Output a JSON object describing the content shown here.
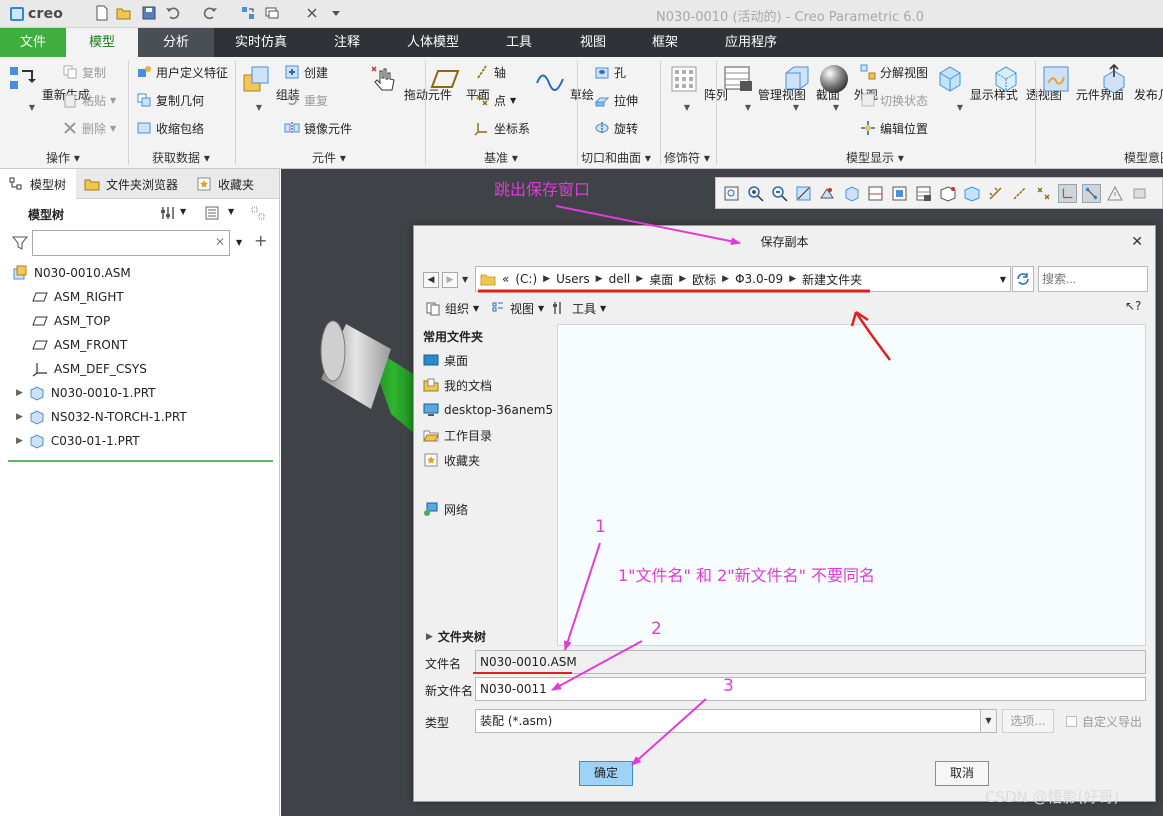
{
  "app": {
    "logo": "creo",
    "window_title": "N030-0010 (活动的) - Creo Parametric 6.0"
  },
  "tabs": [
    "文件",
    "模型",
    "分析",
    "实时仿真",
    "注释",
    "人体模型",
    "工具",
    "视图",
    "框架",
    "应用程序"
  ],
  "ribbon": {
    "operations": {
      "regenerate": "重新生成",
      "copy": "复制",
      "paste": "粘贴",
      "delete": "删除",
      "label": "操作"
    },
    "get_data": {
      "udf": "用户定义特征",
      "copy_geometry": "复制几何",
      "shrinkwrap": "收缩包络",
      "label": "获取数据"
    },
    "component": {
      "assemble": "组装",
      "create": "创建",
      "repeat": "重复",
      "mirror": "镜像元件",
      "drag": "拖动元件",
      "label": "元件"
    },
    "datum": {
      "plane": "平面",
      "axis": "轴",
      "point": "点",
      "csys": "坐标系",
      "sketch": "草绘",
      "label": "基准"
    },
    "cut_surface": {
      "hole": "孔",
      "extrude": "拉伸",
      "revolve": "旋转",
      "label": "切口和曲面"
    },
    "modifiers": {
      "pattern": "阵列",
      "label": "修饰符"
    },
    "model_display": {
      "manage_views": "管理视图",
      "section": "截面",
      "appearance": "外观",
      "explode": "分解视图",
      "toggle_status": "切换状态",
      "edit_position": "编辑位置",
      "display_style": "显示样式",
      "perspective": "透视图",
      "label": "模型显示"
    },
    "model_intent": {
      "component_interface": "元件界面",
      "publish_geometry": "发布几何",
      "label": "模型意图"
    }
  },
  "left_panel": {
    "tabs": [
      "模型树",
      "文件夹浏览器",
      "收藏夹"
    ],
    "tree_title": "模型树",
    "filter_placeholder": "",
    "tree_items": [
      "N030-0010.ASM",
      "ASM_RIGHT",
      "ASM_TOP",
      "ASM_FRONT",
      "ASM_DEF_CSYS",
      "N030-0010-1.PRT",
      "NS032-N-TORCH-1.PRT",
      "C030-01-1.PRT"
    ]
  },
  "dialog": {
    "title": "保存副本",
    "path": [
      "«",
      "(C:)",
      "Users",
      "dell",
      "桌面",
      "欧标",
      "Φ3.0-09",
      "新建文件夹"
    ],
    "search_placeholder": "搜索...",
    "toolbar": {
      "organize": "组织",
      "views": "视图",
      "tools": "工具"
    },
    "nav_heading": "常用文件夹",
    "nav_items": [
      "桌面",
      "我的文档",
      "desktop-36anem5",
      "工作目录",
      "收藏夹",
      "网络"
    ],
    "folder_tree": "文件夹树",
    "filename_label": "文件名",
    "filename_value": "N030-0010.ASM",
    "newname_label": "新文件名",
    "newname_value": "N030-0011",
    "type_label": "类型",
    "type_value": "装配 (*.asm)",
    "options_button": "选项...",
    "custom_export": "自定义导出",
    "ok_button": "确定",
    "cancel_button": "取消"
  },
  "annotations": {
    "popup_note": "跳出保存窗口",
    "num1": "1",
    "num2": "2",
    "num3": "3",
    "rule": "1\"文件名\" 和 2\"新文件名\" 不要同名",
    "color": "#e23ad8",
    "underline_color": "#e0201a"
  },
  "watermark": "CSDN @悟影(好哥)",
  "colors": {
    "file_tab": "#3fae3f",
    "tab_bar": "#2f3338",
    "ok_button": "#9ed3f5",
    "model_green": "#25a025"
  }
}
